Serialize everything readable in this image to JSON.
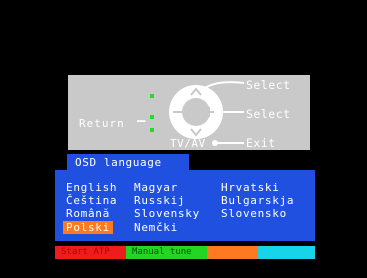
{
  "remote_help": {
    "select_up": "Select",
    "select_right": "Select",
    "exit": "Exit",
    "return": "Return",
    "return_dash": "–",
    "tv_av": "TV/AV",
    "colors": {
      "panel": "#c9c9c9",
      "indicator": "#22dd22"
    }
  },
  "menu": {
    "title": "OSD language",
    "languages": [
      "English",
      "Magyar",
      "Hrvatski",
      "Čeština",
      "Russkij",
      "Bulgarskja",
      "Română",
      "Slovensky",
      "Slovensko",
      "Polski",
      "Nemčki"
    ],
    "selected": "Polski",
    "colors": {
      "box": "#1f50e0",
      "highlight": "#ff7a1e"
    }
  },
  "color_keys": {
    "red": "Start ATP",
    "green": "Manual tune",
    "yellow": "",
    "blue": ""
  }
}
